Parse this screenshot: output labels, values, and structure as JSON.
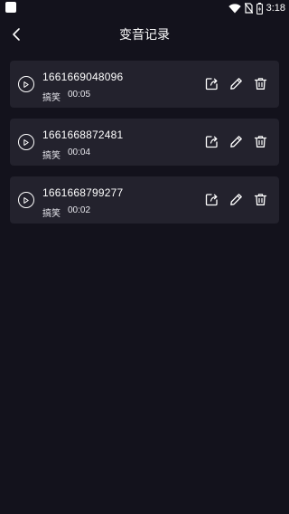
{
  "status_bar": {
    "time": "3:18",
    "icons": [
      "wifi-icon",
      "no-sim-icon",
      "battery-icon"
    ]
  },
  "header": {
    "title": "变音记录",
    "back_icon": "chevron-left-icon"
  },
  "records": [
    {
      "name": "1661669048096",
      "type": "搞笑",
      "duration": "00:05"
    },
    {
      "name": "1661668872481",
      "type": "搞笑",
      "duration": "00:04"
    },
    {
      "name": "1661668799277",
      "type": "搞笑",
      "duration": "00:02"
    }
  ],
  "row_icons": {
    "play": "play-icon",
    "share": "share-icon",
    "edit": "edit-icon",
    "delete": "trash-icon"
  },
  "colors": {
    "background": "#13121c",
    "card": "#23222d",
    "text": "#ffffff"
  }
}
